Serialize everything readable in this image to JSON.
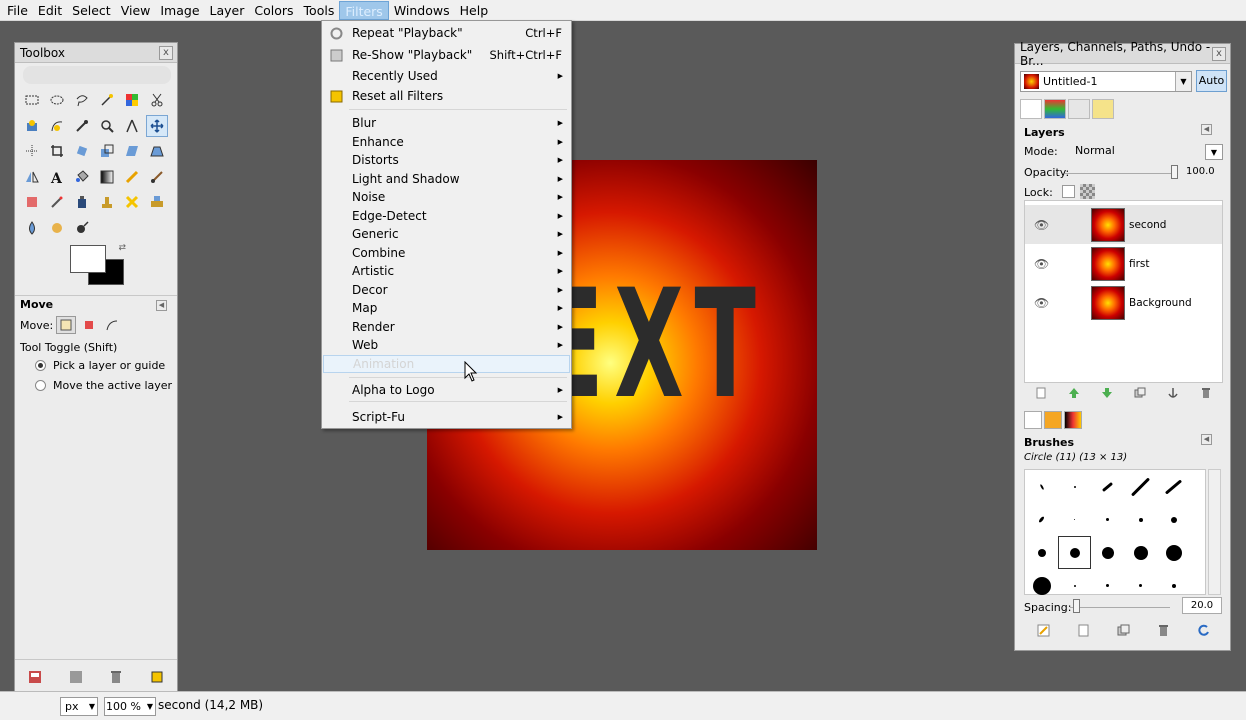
{
  "menubar": [
    "File",
    "Edit",
    "Select",
    "View",
    "Image",
    "Layer",
    "Colors",
    "Tools",
    "Filters",
    "Windows",
    "Help"
  ],
  "toolbox": {
    "title": "Toolbox",
    "close": "x",
    "tool_options_title": "Move",
    "move_label": "Move:",
    "toggle_label": "Tool Toggle  (Shift)",
    "radio_pick": "Pick a layer or guide",
    "radio_move": "Move the active layer"
  },
  "filters_menu": {
    "repeat": "Repeat \"Playback\"",
    "repeat_sc": "Ctrl+F",
    "reshow": "Re-Show \"Playback\"",
    "reshow_sc": "Shift+Ctrl+F",
    "recent": "Recently Used",
    "reset": "Reset all Filters",
    "items": [
      "Blur",
      "Enhance",
      "Distorts",
      "Light and Shadow",
      "Noise",
      "Edge-Detect",
      "Generic",
      "Combine",
      "Artistic",
      "Decor",
      "Map",
      "Render",
      "Web"
    ],
    "animation": "Animation",
    "alpha_logo": "Alpha to Logo",
    "script_fu": "Script-Fu"
  },
  "canvas": {
    "text": "EXT"
  },
  "layers_panel": {
    "title": "Layers, Channels, Paths, Undo - Br...",
    "image_name": "Untitled-1",
    "auto": "Auto",
    "layers_head": "Layers",
    "mode_label": "Mode:",
    "mode_value": "Normal",
    "opacity_label": "Opacity:",
    "opacity_value": "100.0",
    "lock_label": "Lock:",
    "layers": [
      "second",
      "first",
      "Background"
    ],
    "brushes_head": "Brushes",
    "brush_name": "Circle (11) (13 × 13)",
    "spacing_label": "Spacing:",
    "spacing_value": "20.0"
  },
  "statusbar": {
    "unit": "px",
    "zoom": "100 %",
    "status": "second (14,2 MB)"
  }
}
